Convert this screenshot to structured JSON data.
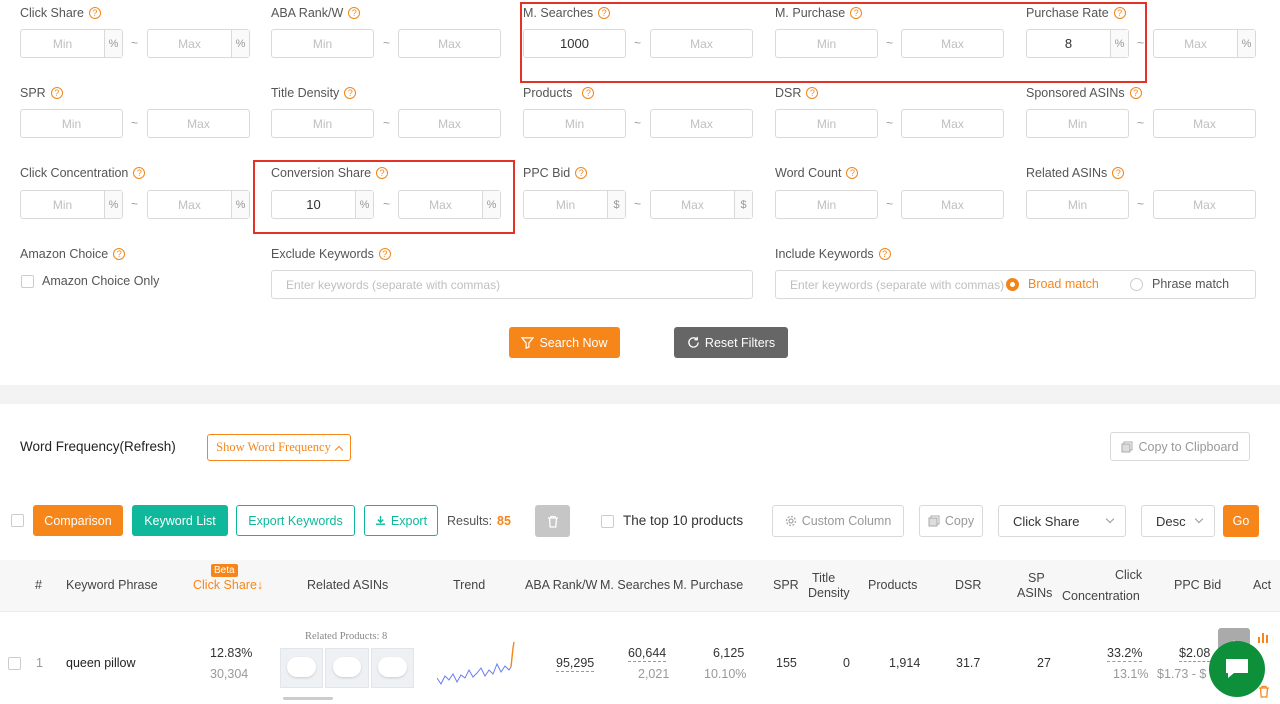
{
  "filters": {
    "click_share": {
      "label": "Click Share",
      "min_ph": "Min",
      "max_ph": "Max",
      "suffix": "%"
    },
    "aba_rank": {
      "label": "ABA Rank/W",
      "min_ph": "Min",
      "max_ph": "Max"
    },
    "m_searches": {
      "label": "M. Searches",
      "min_value": "1000",
      "max_ph": "Max"
    },
    "m_purchase": {
      "label": "M. Purchase",
      "min_ph": "Min",
      "max_ph": "Max"
    },
    "purchase_rate": {
      "label": "Purchase Rate",
      "min_value": "8",
      "max_ph": "Max",
      "suffix": "%"
    },
    "spr": {
      "label": "SPR",
      "min_ph": "Min",
      "max_ph": "Max"
    },
    "title_density": {
      "label": "Title Density",
      "min_ph": "Min",
      "max_ph": "Max"
    },
    "products": {
      "label": "Products",
      "min_ph": "Min",
      "max_ph": "Max"
    },
    "dsr": {
      "label": "DSR",
      "min_ph": "Min",
      "max_ph": "Max"
    },
    "sponsored_asins": {
      "label": "Sponsored ASINs",
      "min_ph": "Min",
      "max_ph": "Max"
    },
    "click_concentration": {
      "label": "Click Concentration",
      "min_ph": "Min",
      "max_ph": "Max",
      "suffix": "%"
    },
    "conversion_share": {
      "label": "Conversion Share",
      "min_value": "10",
      "max_ph": "Max",
      "suffix": "%"
    },
    "ppc_bid": {
      "label": "PPC Bid",
      "min_ph": "Min",
      "max_ph": "Max",
      "suffix": "$"
    },
    "word_count": {
      "label": "Word Count",
      "min_ph": "Min",
      "max_ph": "Max"
    },
    "related_asins": {
      "label": "Related ASINs",
      "min_ph": "Min",
      "max_ph": "Max"
    },
    "amazon_choice": {
      "label": "Amazon Choice",
      "checkbox_label": "Amazon Choice Only"
    },
    "exclude_keywords": {
      "label": "Exclude Keywords",
      "placeholder": "Enter keywords (separate with commas)"
    },
    "include_keywords": {
      "label": "Include Keywords",
      "placeholder": "Enter keywords (separate with commas)",
      "broad": "Broad match",
      "phrase": "Phrase match"
    },
    "tilde": "~",
    "search_btn": "Search Now",
    "reset_btn": "Reset Filters"
  },
  "word_freq": {
    "title": "Word Frequency(Refresh)",
    "toggle": "Show Word Frequency",
    "copy": "Copy to Clipboard"
  },
  "toolbar": {
    "comparison": "Comparison",
    "keyword_list": "Keyword List",
    "export_keywords": "Export Keywords",
    "export": "Export",
    "results_label": "Results:",
    "results_count": "85",
    "top10": "The top 10 products",
    "custom_column": "Custom Column",
    "copy": "Copy",
    "sort_field": "Click Share",
    "sort_order": "Desc",
    "go": "Go"
  },
  "table": {
    "headers": {
      "num": "#",
      "keyword": "Keyword Phrase",
      "beta": "Beta",
      "click_share": "Click Share↓",
      "related": "Related ASINs",
      "trend": "Trend",
      "aba": "ABA Rank/W",
      "searches": "M. Searches",
      "purchase": "M. Purchase",
      "spr": "SPR",
      "title_density_1": "Title",
      "title_density_2": "Density",
      "products": "Products",
      "dsr": "DSR",
      "sp_1": "SP",
      "sp_2": "ASINs",
      "cc_1": "Click",
      "cc_2": "Concentration",
      "ppc": "PPC Bid",
      "act": "Act"
    },
    "row": {
      "num": "1",
      "keyword": "queen pillow",
      "click_share": "12.83%",
      "click_share_sub": "30,304",
      "related_label": "Related Products: 8",
      "aba": "95,295",
      "searches": "60,644",
      "searches_sub": "2,021",
      "purchase": "6,125",
      "purchase_sub": "10.10%",
      "spr": "155",
      "title_density": "0",
      "products": "1,914",
      "dsr": "31.7",
      "sp_asins": "27",
      "cc": "33.2%",
      "cc_sub": "13.1%",
      "ppc": "$2.08",
      "ppc_sub": "$1.73 - $"
    }
  },
  "colors": {
    "accent": "#f7861a",
    "green": "#0fb89b",
    "highlight": "#e53226"
  }
}
